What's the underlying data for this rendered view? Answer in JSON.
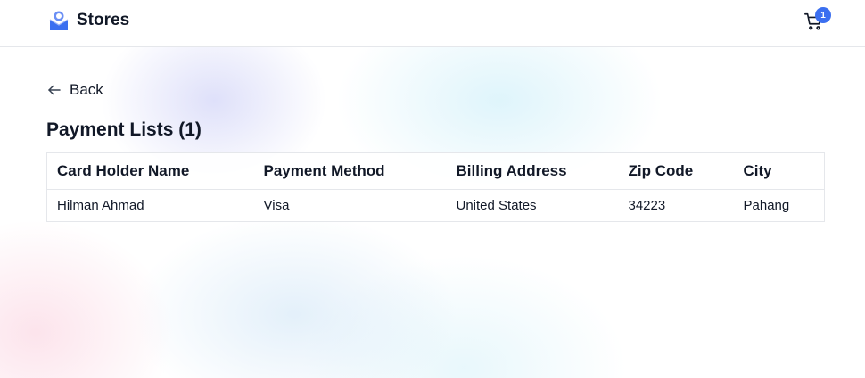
{
  "header": {
    "brand_name": "Stores",
    "brand_logo_icon": "envelope-logo-icon",
    "cart_icon": "cart-icon",
    "cart_count": "1",
    "accent_color": "#3b6ff0"
  },
  "back": {
    "label": "Back",
    "icon": "arrow-left-icon"
  },
  "page": {
    "title": "Payment Lists (1)"
  },
  "table": {
    "columns": [
      "Card Holder Name",
      "Payment Method",
      "Billing Address",
      "Zip Code",
      "City"
    ],
    "rows": [
      [
        "Hilman Ahmad",
        "Visa",
        "United States",
        "34223",
        "Pahang"
      ]
    ]
  }
}
